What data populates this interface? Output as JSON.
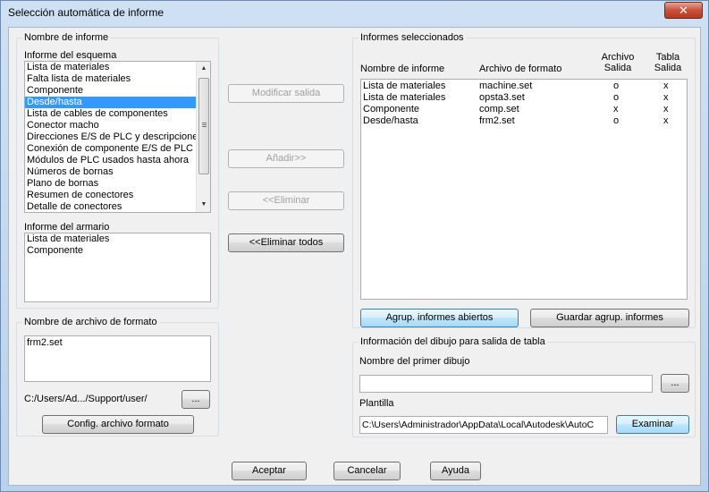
{
  "window": {
    "title": "Selección automática de informe",
    "close_glyph": "✕"
  },
  "left": {
    "report_name_group": "Nombre de informe",
    "schematic_label": "Informe del esquema",
    "schematic_items": [
      "Lista de materiales",
      "Falta lista de materiales",
      "Componente",
      "Desde/hasta",
      "Lista de cables de componentes",
      "Conector macho",
      "Direcciones E/S de PLC y descripciones",
      "Conexión de componente E/S de PLC",
      "Módulos de PLC usados hasta ahora",
      "Números de bornas",
      "Plano de bornas",
      "Resumen de conectores",
      "Detalle de conectores"
    ],
    "schematic_selected_index": 3,
    "panel_label": "Informe del armario",
    "panel_items": [
      "Lista de materiales",
      "Componente"
    ],
    "format_group": "Nombre de archivo de formato",
    "format_items": [
      "frm2.set"
    ],
    "format_path": "C:/Users/Ad.../Support/user/",
    "browse_label": "...",
    "config_button": "Config. archivo formato"
  },
  "middle": {
    "modify_output": "Modificar salida",
    "add": "Añadir>>",
    "remove": "<<Eliminar",
    "remove_all": "<<Eliminar todos"
  },
  "right": {
    "selected_group": "Informes seleccionados",
    "headers": {
      "name": "Nombre de informe",
      "format_file": "Archivo de formato",
      "file_output_1": "Archivo",
      "file_output_2": "Salida",
      "table_output_1": "Tabla",
      "table_output_2": "Salida"
    },
    "rows": [
      {
        "name": "Lista de materiales",
        "file": "machine.set",
        "file_out": "o",
        "table_out": "x"
      },
      {
        "name": "Lista de materiales",
        "file": "opsta3.set",
        "file_out": "o",
        "table_out": "x"
      },
      {
        "name": "Componente",
        "file": "comp.set",
        "file_out": "x",
        "table_out": "x"
      },
      {
        "name": "Desde/hasta",
        "file": "frm2.set",
        "file_out": "o",
        "table_out": "x"
      }
    ],
    "open_group_button": "Agrup. informes abiertos",
    "save_group_button": "Guardar agrup. informes",
    "drawing_group": "Información del dibujo para salida de tabla",
    "first_drawing_label": "Nombre del primer dibujo",
    "first_drawing_value": "",
    "browse_label": "...",
    "template_label": "Plantilla",
    "template_value": "C:\\Users\\Administrador\\AppData\\Local\\Autodesk\\AutoC",
    "browse_button": "Examinar"
  },
  "footer": {
    "accept": "Aceptar",
    "cancel": "Cancelar",
    "help": "Ayuda"
  }
}
